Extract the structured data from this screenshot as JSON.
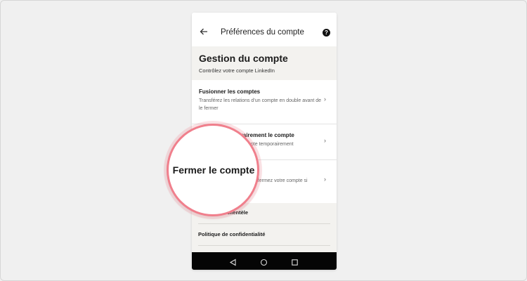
{
  "app": {
    "title": "Préférences du compte",
    "help_symbol": "?"
  },
  "section": {
    "heading": "Gestion du compte",
    "subheading": "Contrôlez votre compte LinkedIn"
  },
  "rows": [
    {
      "title": "Fusionner les comptes",
      "description": "Transférez les relations d’un compte en double avant de le fermer"
    },
    {
      "title_partial": "oorairement le compte",
      "description_partial": "npte temporairement"
    },
    {
      "description_partial": "et fermez votre compte si"
    }
  ],
  "magnifier": {
    "label": "Fermer le compte"
  },
  "other_links": [
    {
      "label_partial": "clientèle"
    },
    {
      "label": "Politique de confidentialité"
    }
  ],
  "chevron_symbol": "›",
  "icons": {
    "back": "arrow-left-icon",
    "help": "help-circle-icon",
    "chevron": "chevron-right-icon",
    "nav_back": "triangle-back-icon",
    "nav_home": "circle-home-icon",
    "nav_recents": "square-recents-icon"
  },
  "colors": {
    "background": "#f0f0f0",
    "section_bg": "#f3f2ef",
    "magnifier_ring": "#f07f8c",
    "navbar": "#050505"
  }
}
